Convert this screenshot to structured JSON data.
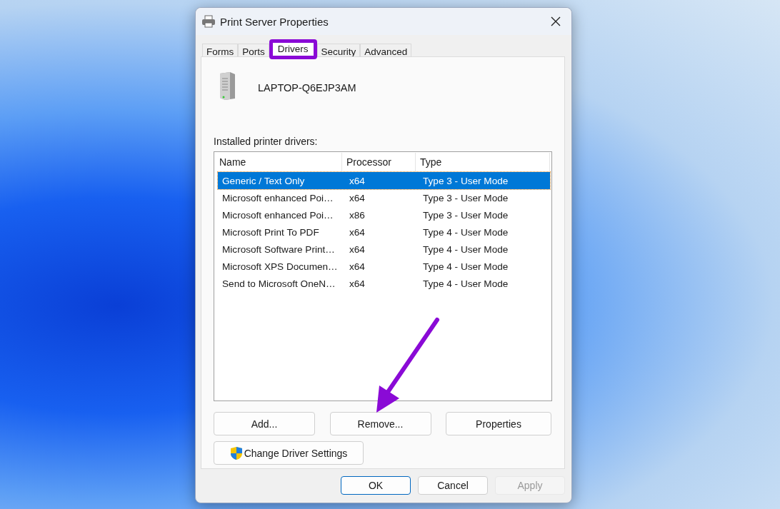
{
  "window": {
    "title": "Print Server Properties"
  },
  "tabs": [
    {
      "label": "Forms",
      "selected": false
    },
    {
      "label": "Ports",
      "selected": false
    },
    {
      "label": "Drivers",
      "selected": true
    },
    {
      "label": "Security",
      "selected": false
    },
    {
      "label": "Advanced",
      "selected": false
    }
  ],
  "server_name": "LAPTOP-Q6EJP3AM",
  "list_label": "Installed printer drivers:",
  "table": {
    "columns": [
      "Name",
      "Processor",
      "Type"
    ],
    "rows": [
      {
        "cells": [
          "Generic / Text Only",
          "x64",
          "Type 3 - User Mode"
        ],
        "selected": true
      },
      {
        "cells": [
          "Microsoft enhanced Poi…",
          "x64",
          "Type 3 - User Mode"
        ],
        "selected": false
      },
      {
        "cells": [
          "Microsoft enhanced Poi…",
          "x86",
          "Type 3 - User Mode"
        ],
        "selected": false
      },
      {
        "cells": [
          "Microsoft Print To PDF",
          "x64",
          "Type 4 - User Mode"
        ],
        "selected": false
      },
      {
        "cells": [
          "Microsoft Software Print…",
          "x64",
          "Type 4 - User Mode"
        ],
        "selected": false
      },
      {
        "cells": [
          "Microsoft XPS Documen…",
          "x64",
          "Type 4 - User Mode"
        ],
        "selected": false
      },
      {
        "cells": [
          "Send to Microsoft OneN…",
          "x64",
          "Type 4 - User Mode"
        ],
        "selected": false
      }
    ]
  },
  "action_buttons": [
    "Add...",
    "Remove...",
    "Properties"
  ],
  "change_settings_button": "Change Driver Settings",
  "dialog_buttons": [
    {
      "label": "OK",
      "default": true,
      "disabled": false
    },
    {
      "label": "Cancel",
      "default": false,
      "disabled": false
    },
    {
      "label": "Apply",
      "default": false,
      "disabled": true
    }
  ]
}
